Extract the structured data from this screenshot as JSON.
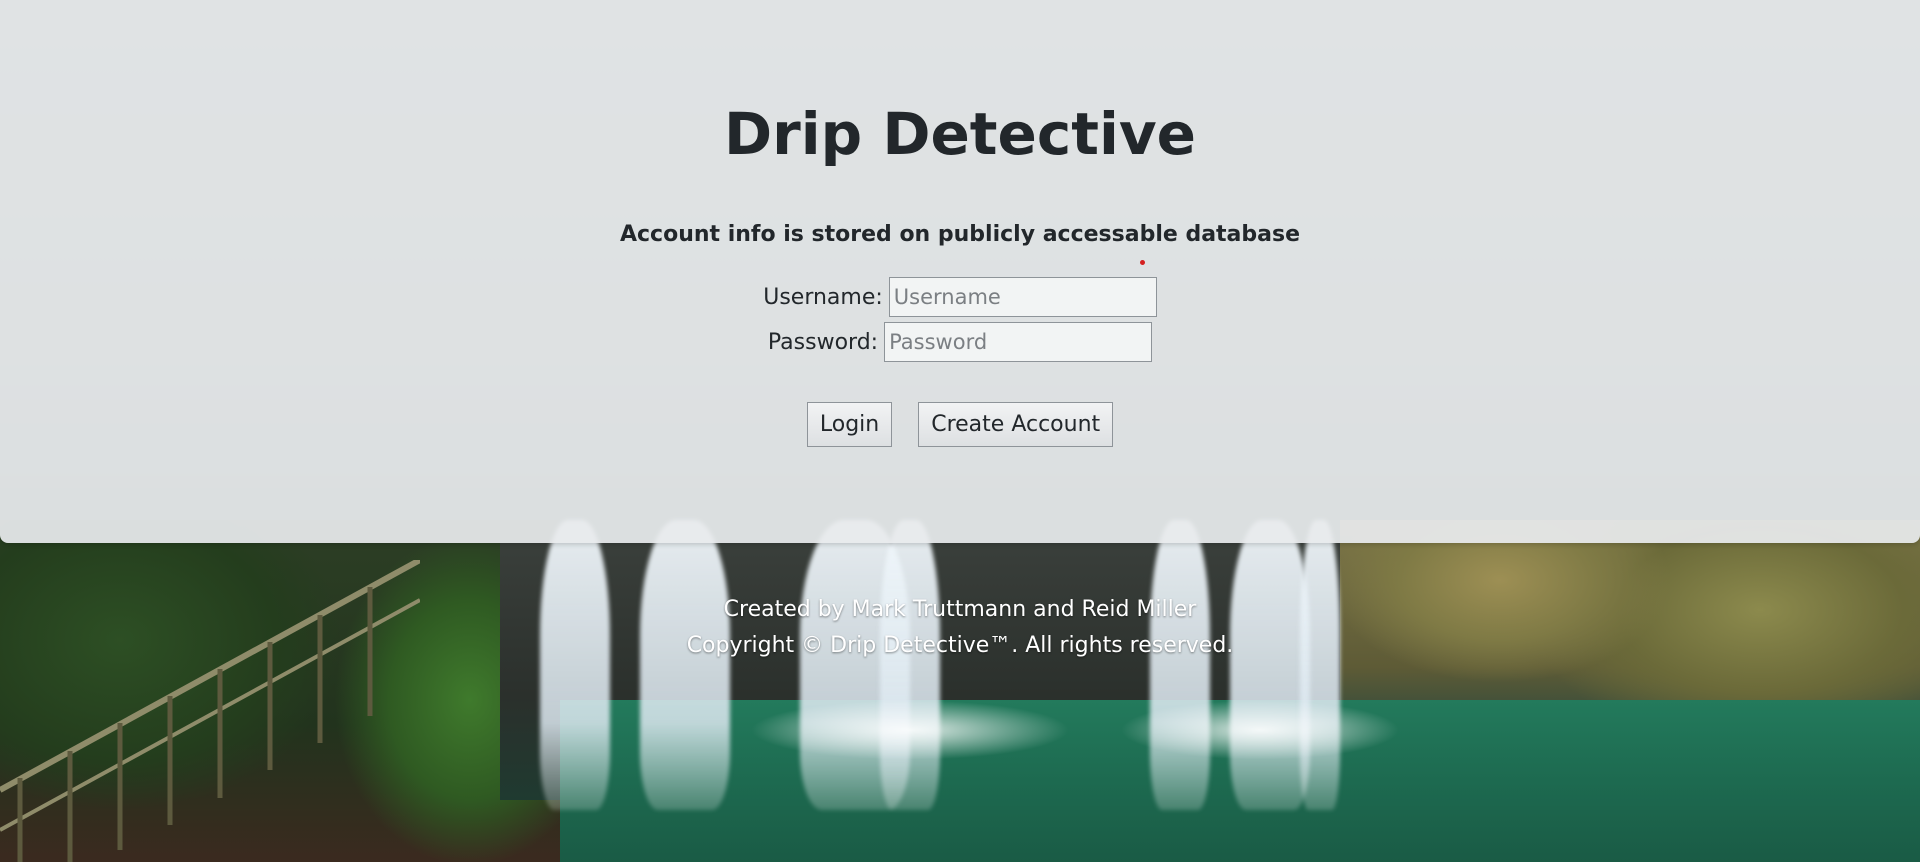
{
  "app": {
    "title": "Drip Detective",
    "notice": "Account info is stored on publicly accessable database"
  },
  "form": {
    "username_label": "Username:",
    "username_placeholder": "Username",
    "username_value": "",
    "password_label": "Password:",
    "password_placeholder": "Password",
    "password_value": ""
  },
  "actions": {
    "login_label": "Login",
    "create_account_label": "Create Account"
  },
  "footer": {
    "credits": "Created by Mark Truttmann and Reid Miller",
    "copyright": "Copyright © Drip Detective™. All rights reserved."
  },
  "colors": {
    "panel": "#e8ebed",
    "text": "#22272b",
    "footer_text": "#ffffff"
  },
  "background": {
    "icon": "waterfall-photo"
  }
}
